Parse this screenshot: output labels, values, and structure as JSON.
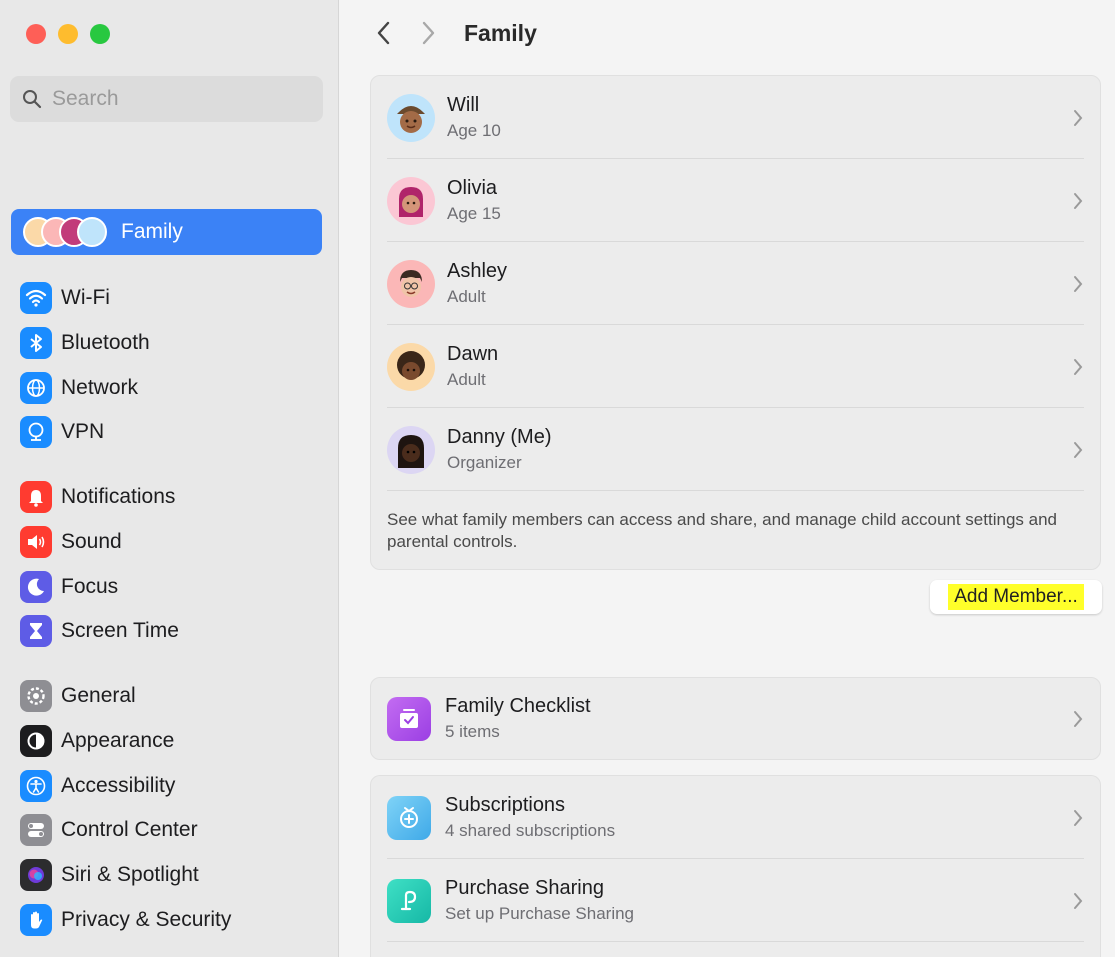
{
  "window": {
    "title": "Family"
  },
  "sidebar": {
    "search": {
      "placeholder": "Search",
      "value": ""
    },
    "selected": {
      "label": "Family"
    },
    "groups": [
      [
        {
          "label": "Wi-Fi",
          "icon": "wifi-icon",
          "color": "#1a8cff"
        },
        {
          "label": "Bluetooth",
          "icon": "bluetooth-icon",
          "color": "#1a8cff"
        },
        {
          "label": "Network",
          "icon": "globe-icon",
          "color": "#1a8cff"
        },
        {
          "label": "VPN",
          "icon": "vpn-icon",
          "color": "#1a8cff"
        }
      ],
      [
        {
          "label": "Notifications",
          "icon": "bell-icon",
          "color": "#ff3b30"
        },
        {
          "label": "Sound",
          "icon": "speaker-icon",
          "color": "#ff3b30"
        },
        {
          "label": "Focus",
          "icon": "moon-icon",
          "color": "#5e5ce6"
        },
        {
          "label": "Screen Time",
          "icon": "hourglass-icon",
          "color": "#5e5ce6"
        }
      ],
      [
        {
          "label": "General",
          "icon": "gear-icon",
          "color": "#8e8e93"
        },
        {
          "label": "Appearance",
          "icon": "appearance-icon",
          "color": "#1c1c1e"
        },
        {
          "label": "Accessibility",
          "icon": "accessibility-icon",
          "color": "#1a8cff"
        },
        {
          "label": "Control Center",
          "icon": "control-center-icon",
          "color": "#8e8e93"
        },
        {
          "label": "Siri & Spotlight",
          "icon": "siri-icon",
          "color": "#2c2c2e"
        },
        {
          "label": "Privacy & Security",
          "icon": "hand-icon",
          "color": "#1a8cff"
        }
      ]
    ]
  },
  "main": {
    "title": "Family",
    "members": [
      {
        "name": "Will",
        "role": "Age 10",
        "bg": "#bfe4fb"
      },
      {
        "name": "Olivia",
        "role": "Age 15",
        "bg": "#fbc7d4"
      },
      {
        "name": "Ashley",
        "role": "Adult",
        "bg": "#fbb7b7"
      },
      {
        "name": "Dawn",
        "role": "Adult",
        "bg": "#fbd9a8"
      },
      {
        "name": "Danny (Me)",
        "role": "Organizer",
        "bg": "#dcd6f3"
      }
    ],
    "footnote": "See what family members can access and share, and manage child account settings and parental controls.",
    "add_member": "Add Member...",
    "checklist": {
      "title": "Family Checklist",
      "sub": "5 items"
    },
    "subscriptions": {
      "title": "Subscriptions",
      "sub": "4 shared subscriptions"
    },
    "purchase": {
      "title": "Purchase Sharing",
      "sub": "Set up Purchase Sharing"
    }
  }
}
